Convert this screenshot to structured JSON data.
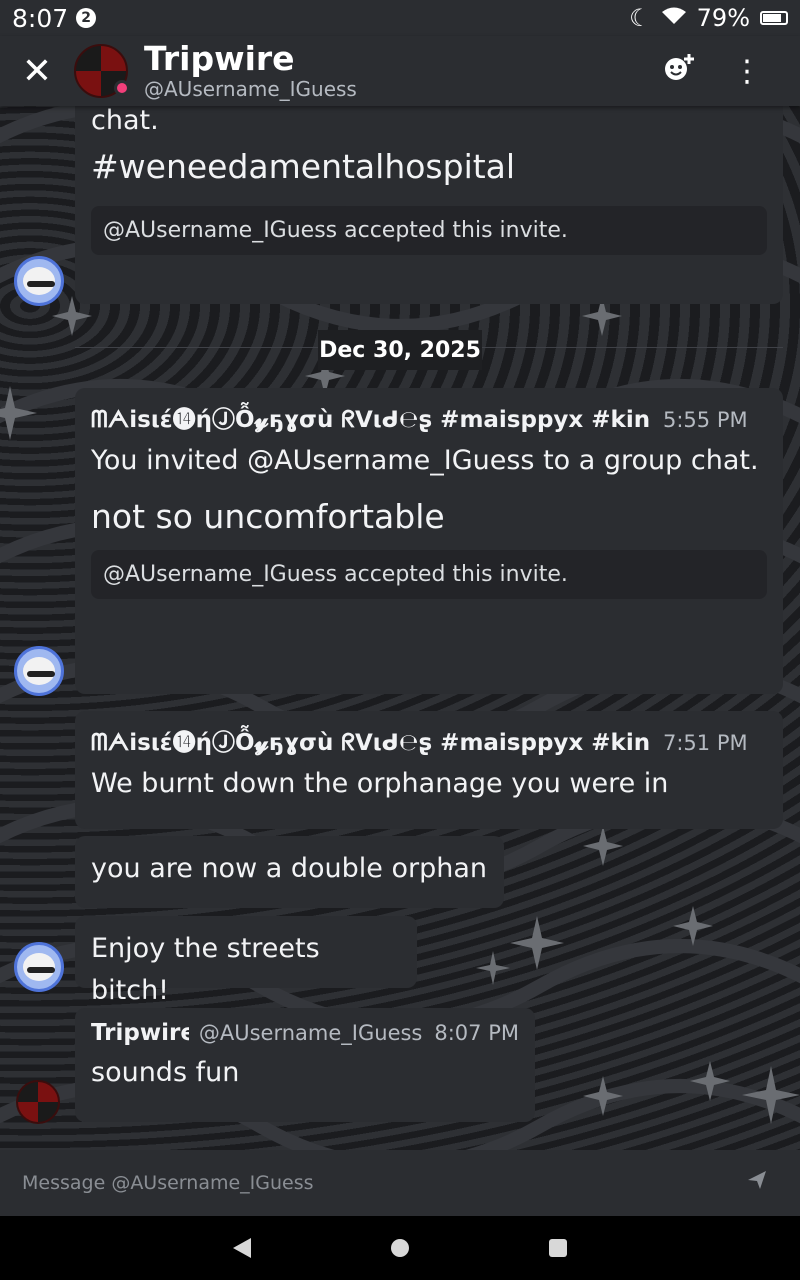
{
  "status_bar": {
    "time": "8:07",
    "notification_count": "2",
    "battery": "79%"
  },
  "header": {
    "title": "Tripwire",
    "subtitle": "@AUsername_IGuess"
  },
  "messages": {
    "m1": {
      "line_partial": "chat.",
      "big_text": "#weneedamentalhospital",
      "embed": "@AUsername_IGuess accepted this invite."
    },
    "date_separator": "Dec 30, 2025",
    "m2": {
      "author": "ᗰᗅisιέ⓮ήⒿỖ𝔂ҕɣσù ᖇᐯιᑯ℮ʂ #maisppyx #kings",
      "time": "5:55 PM",
      "text": "You invited @AUsername_IGuess to a group chat.",
      "big_text": "not so uncomfortable",
      "embed": "@AUsername_IGuess accepted this invite."
    },
    "m3": {
      "author": "ᗰᗅisιέ⓮ήⒿỖ𝔂ҕɣσù ᖇᐯιᑯ℮ʂ #maisppyx #kings",
      "time": "7:51 PM",
      "text": "We burnt down the orphanage you were in"
    },
    "m4": {
      "text": "you are now a double orphan"
    },
    "m5": {
      "text": "Enjoy the streets bitch!"
    },
    "m6": {
      "author": "Tripwire",
      "handle": "@AUsername_IGuess",
      "time": "8:07 PM",
      "text": "sounds fun"
    }
  },
  "composer": {
    "placeholder": "Message @AUsername_IGuess"
  }
}
